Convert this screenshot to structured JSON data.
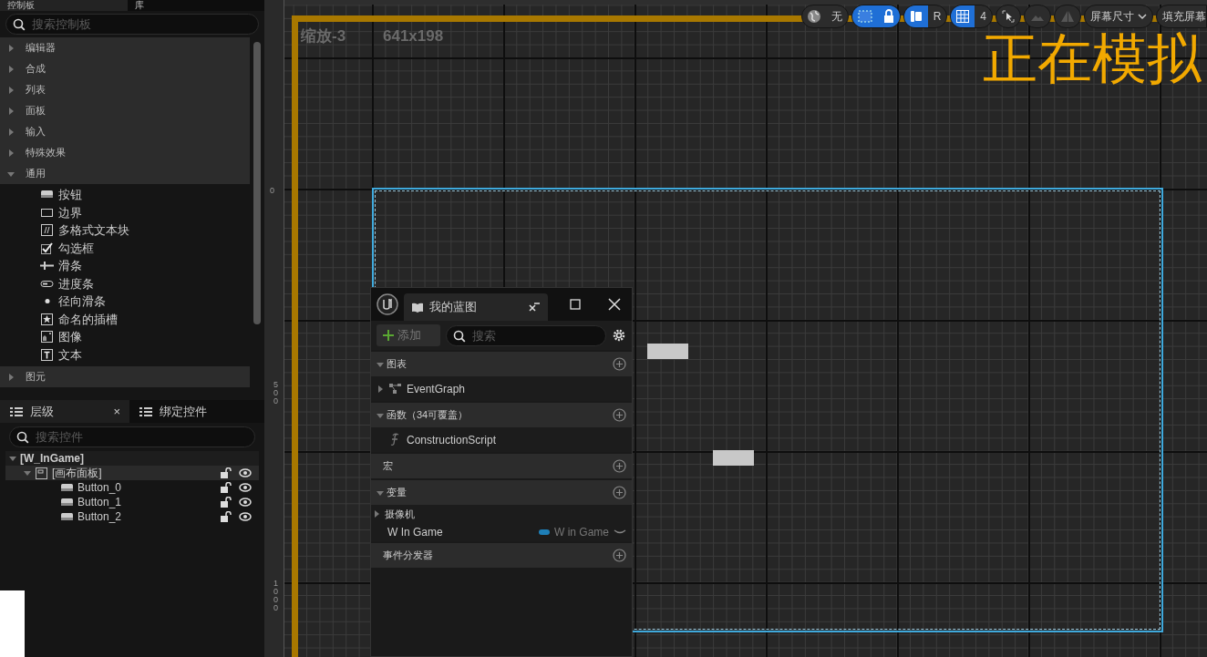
{
  "palette_tabs": [
    {
      "label": "控制板",
      "selected": true
    },
    {
      "label": "库",
      "selected": false
    }
  ],
  "palette_search": {
    "placeholder": "搜索控制板"
  },
  "palette_categories": [
    {
      "label": "编辑器",
      "expanded": false
    },
    {
      "label": "合成",
      "expanded": false
    },
    {
      "label": "列表",
      "expanded": false
    },
    {
      "label": "面板",
      "expanded": false
    },
    {
      "label": "输入",
      "expanded": false
    },
    {
      "label": "特殊效果",
      "expanded": false
    },
    {
      "label": "通用",
      "expanded": true,
      "children": [
        {
          "label": "按钮",
          "kind": "button"
        },
        {
          "label": "边界",
          "kind": "border"
        },
        {
          "label": "多格式文本块",
          "kind": "richtext"
        },
        {
          "label": "勾选框",
          "kind": "checkbox"
        },
        {
          "label": "滑条",
          "kind": "slider"
        },
        {
          "label": "进度条",
          "kind": "progress"
        },
        {
          "label": "径向滑条",
          "kind": "radial"
        },
        {
          "label": "命名的插槽",
          "kind": "slot"
        },
        {
          "label": "图像",
          "kind": "image"
        },
        {
          "label": "文本",
          "kind": "text"
        }
      ]
    },
    {
      "label": "图元",
      "expanded": false
    }
  ],
  "hierarchy_tabs": [
    {
      "label": "层级",
      "selected": true,
      "close": "×"
    },
    {
      "label": "绑定控件",
      "selected": false
    }
  ],
  "hierarchy_search": {
    "placeholder": "搜索控件"
  },
  "hierarchy_tree": [
    {
      "label": "[W_InGame]",
      "kind": "root",
      "expanded": true,
      "selected": false,
      "children": [
        {
          "label": "[画布面板]",
          "kind": "canvas",
          "expanded": true,
          "selected": true,
          "locked": false,
          "visible": true,
          "children": [
            {
              "label": "Button_0",
              "kind": "button",
              "selected": false,
              "locked": false,
              "visible": true
            },
            {
              "label": "Button_1",
              "kind": "button",
              "selected": false,
              "locked": false,
              "visible": true
            },
            {
              "label": "Button_2",
              "kind": "button",
              "selected": false,
              "locked": false,
              "visible": true
            }
          ]
        }
      ]
    }
  ],
  "designer": {
    "zoom_label": "缩放-3",
    "resolution": "641x198",
    "overlay_text": "正在模拟",
    "ruler_labels": [
      {
        "text": "0",
        "kind": "horizontal"
      },
      {
        "text": "500",
        "kind": "vertical"
      },
      {
        "text": "1000",
        "kind": "vertical"
      }
    ],
    "toolbar": [
      {
        "kind": "world",
        "label": "无",
        "active": false
      },
      {
        "kind": "marquee-lock",
        "active": true
      },
      {
        "kind": "respect",
        "label": "R",
        "active": true
      },
      {
        "kind": "grid",
        "label": "4",
        "active": true
      },
      {
        "kind": "cursor"
      },
      {
        "kind": "mountain"
      },
      {
        "kind": "mirror"
      },
      {
        "kind": "dropdown",
        "label": "屏幕尺寸"
      },
      {
        "kind": "plain",
        "label": "填充屏幕"
      }
    ]
  },
  "blueprint_window": {
    "tab": "我的蓝图",
    "add_button": "添加",
    "search": {
      "placeholder": "搜索"
    },
    "sections": [
      {
        "title": "图表",
        "kind": "group",
        "expanded": true,
        "items": [
          {
            "label": "EventGraph",
            "kind": "graph"
          }
        ]
      },
      {
        "title": "函数（34可覆盖）",
        "kind": "group",
        "expanded": true,
        "items": [
          {
            "label": "ConstructionScript",
            "kind": "function"
          }
        ]
      },
      {
        "title": "宏",
        "kind": "empty"
      },
      {
        "title": "变量",
        "kind": "group",
        "expanded": true,
        "items": [
          {
            "label": "摄像机",
            "kind": "category"
          },
          {
            "label": "W In Game",
            "kind": "variable",
            "type_label": "W in Game"
          }
        ]
      },
      {
        "title": "事件分发器",
        "kind": "empty"
      }
    ]
  }
}
